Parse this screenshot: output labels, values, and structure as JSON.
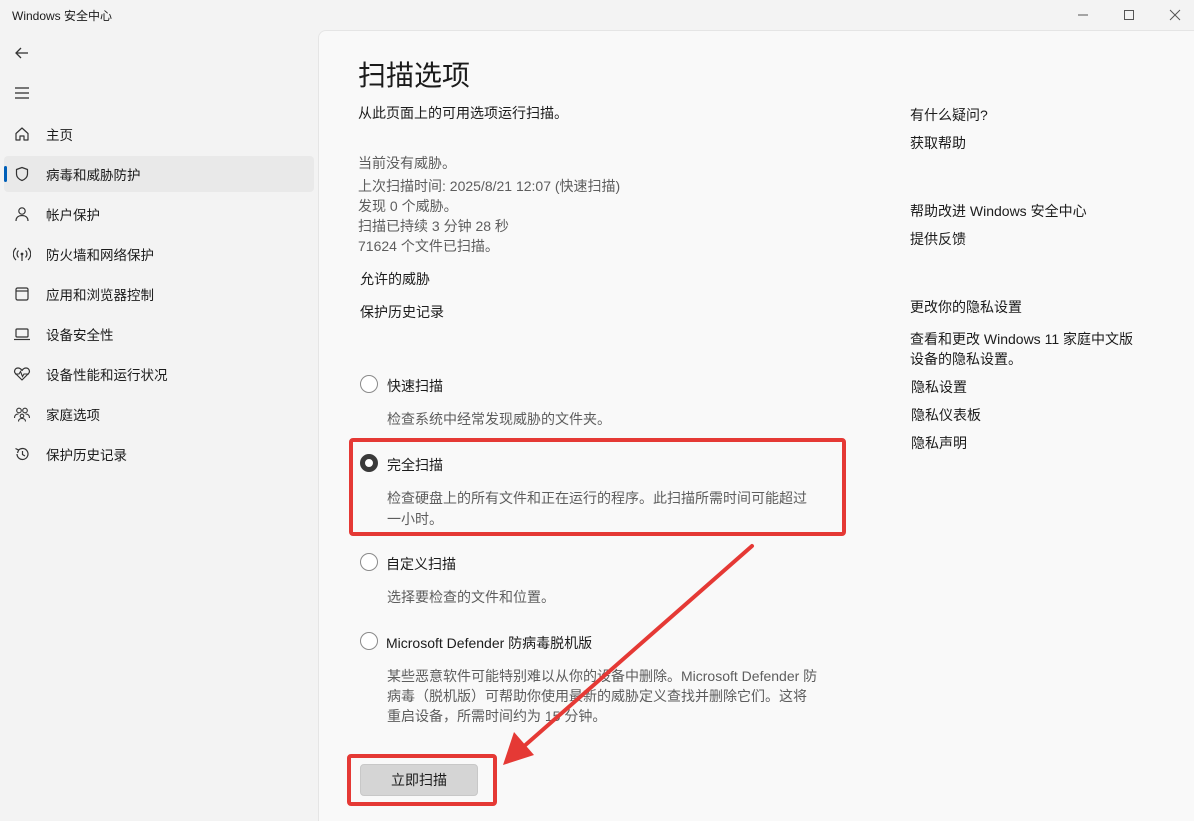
{
  "window": {
    "title": "Windows 安全中心"
  },
  "sidebar": {
    "items": [
      {
        "label": "主页",
        "icon": "home-icon",
        "active": false
      },
      {
        "label": "病毒和威胁防护",
        "icon": "shield-icon",
        "active": true
      },
      {
        "label": "帐户保护",
        "icon": "person-icon",
        "active": false
      },
      {
        "label": "防火墙和网络保护",
        "icon": "wireless-icon",
        "active": false
      },
      {
        "label": "应用和浏览器控制",
        "icon": "app-window-icon",
        "active": false
      },
      {
        "label": "设备安全性",
        "icon": "laptop-icon",
        "active": false
      },
      {
        "label": "设备性能和运行状况",
        "icon": "heart-pulse-icon",
        "active": false
      },
      {
        "label": "家庭选项",
        "icon": "family-icon",
        "active": false
      },
      {
        "label": "保护历史记录",
        "icon": "history-icon",
        "active": false
      }
    ]
  },
  "main": {
    "title": "扫描选项",
    "subtitle": "从此页面上的可用选项运行扫描。",
    "status": {
      "no_threats": "当前没有威胁。",
      "last_scan": "上次扫描时间: 2025/8/21 12:07 (快速扫描)",
      "threats_found": "发现 0 个威胁。",
      "duration": "扫描已持续 3 分钟 28 秒",
      "files_scanned": "71624 个文件已扫描。"
    },
    "links": {
      "allowed_threats": "允许的威胁",
      "protection_history": "保护历史记录"
    },
    "options": [
      {
        "title": "快速扫描",
        "desc": "检查系统中经常发现威胁的文件夹。",
        "selected": false
      },
      {
        "title": "完全扫描",
        "desc_lines": [
          "检查硬盘上的所有文件和正在运行的程序。此扫描所需时间可能超过",
          "一小时。"
        ],
        "selected": true
      },
      {
        "title": "自定义扫描",
        "desc": "选择要检查的文件和位置。",
        "selected": false
      },
      {
        "title": "Microsoft Defender 防病毒脱机版",
        "desc_lines": [
          "某些恶意软件可能特别难以从你的设备中删除。Microsoft Defender 防",
          "病毒（脱机版）可帮助你使用最新的威胁定义查找并删除它们。这将",
          "重启设备，所需时间约为 15 分钟。"
        ],
        "selected": false
      }
    ],
    "scan_button": "立即扫描"
  },
  "right_panel": {
    "help": {
      "heading": "有什么疑问?",
      "link": "获取帮助"
    },
    "improve": {
      "heading": "帮助改进 Windows 安全中心",
      "link": "提供反馈"
    },
    "privacy": {
      "heading": "更改你的隐私设置",
      "desc_lines": [
        "查看和更改 Windows 11 家庭中文版",
        "设备的隐私设置。"
      ],
      "links": [
        "隐私设置",
        "隐私仪表板",
        "隐私声明"
      ]
    }
  },
  "colors": {
    "highlight": "#e53935",
    "accent": "#005fb8"
  }
}
